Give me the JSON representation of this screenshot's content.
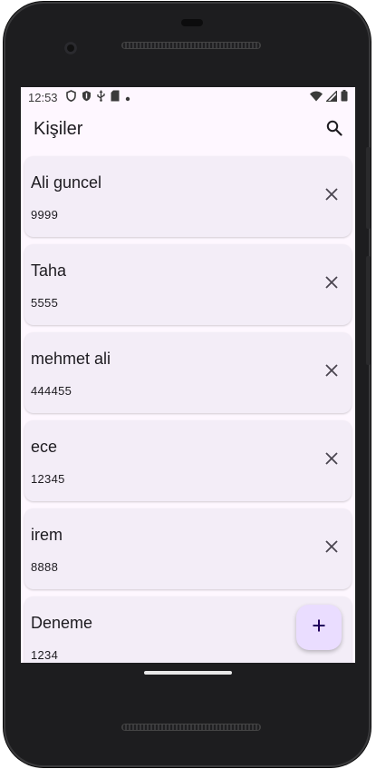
{
  "status_bar": {
    "time": "12:53",
    "left_icons": [
      "shield-outline-icon",
      "shield-icon",
      "usb-icon",
      "sd-card-icon",
      "dot-icon"
    ],
    "right_icons": [
      "wifi-icon",
      "signal-icon",
      "battery-icon"
    ]
  },
  "app_bar": {
    "title": "Kişiler",
    "search_icon": "search-icon"
  },
  "contacts": [
    {
      "name": "Ali guncel",
      "phone": "9999"
    },
    {
      "name": "Taha",
      "phone": "5555"
    },
    {
      "name": "mehmet ali",
      "phone": "444455"
    },
    {
      "name": "ece",
      "phone": "12345"
    },
    {
      "name": "irem",
      "phone": "8888"
    },
    {
      "name": "Deneme",
      "phone": "1234"
    }
  ],
  "fab": {
    "icon": "plus-icon"
  },
  "colors": {
    "background": "#fef7ff",
    "card": "#f3edf7",
    "fab": "#eaddff",
    "text": "#1d1b20"
  }
}
